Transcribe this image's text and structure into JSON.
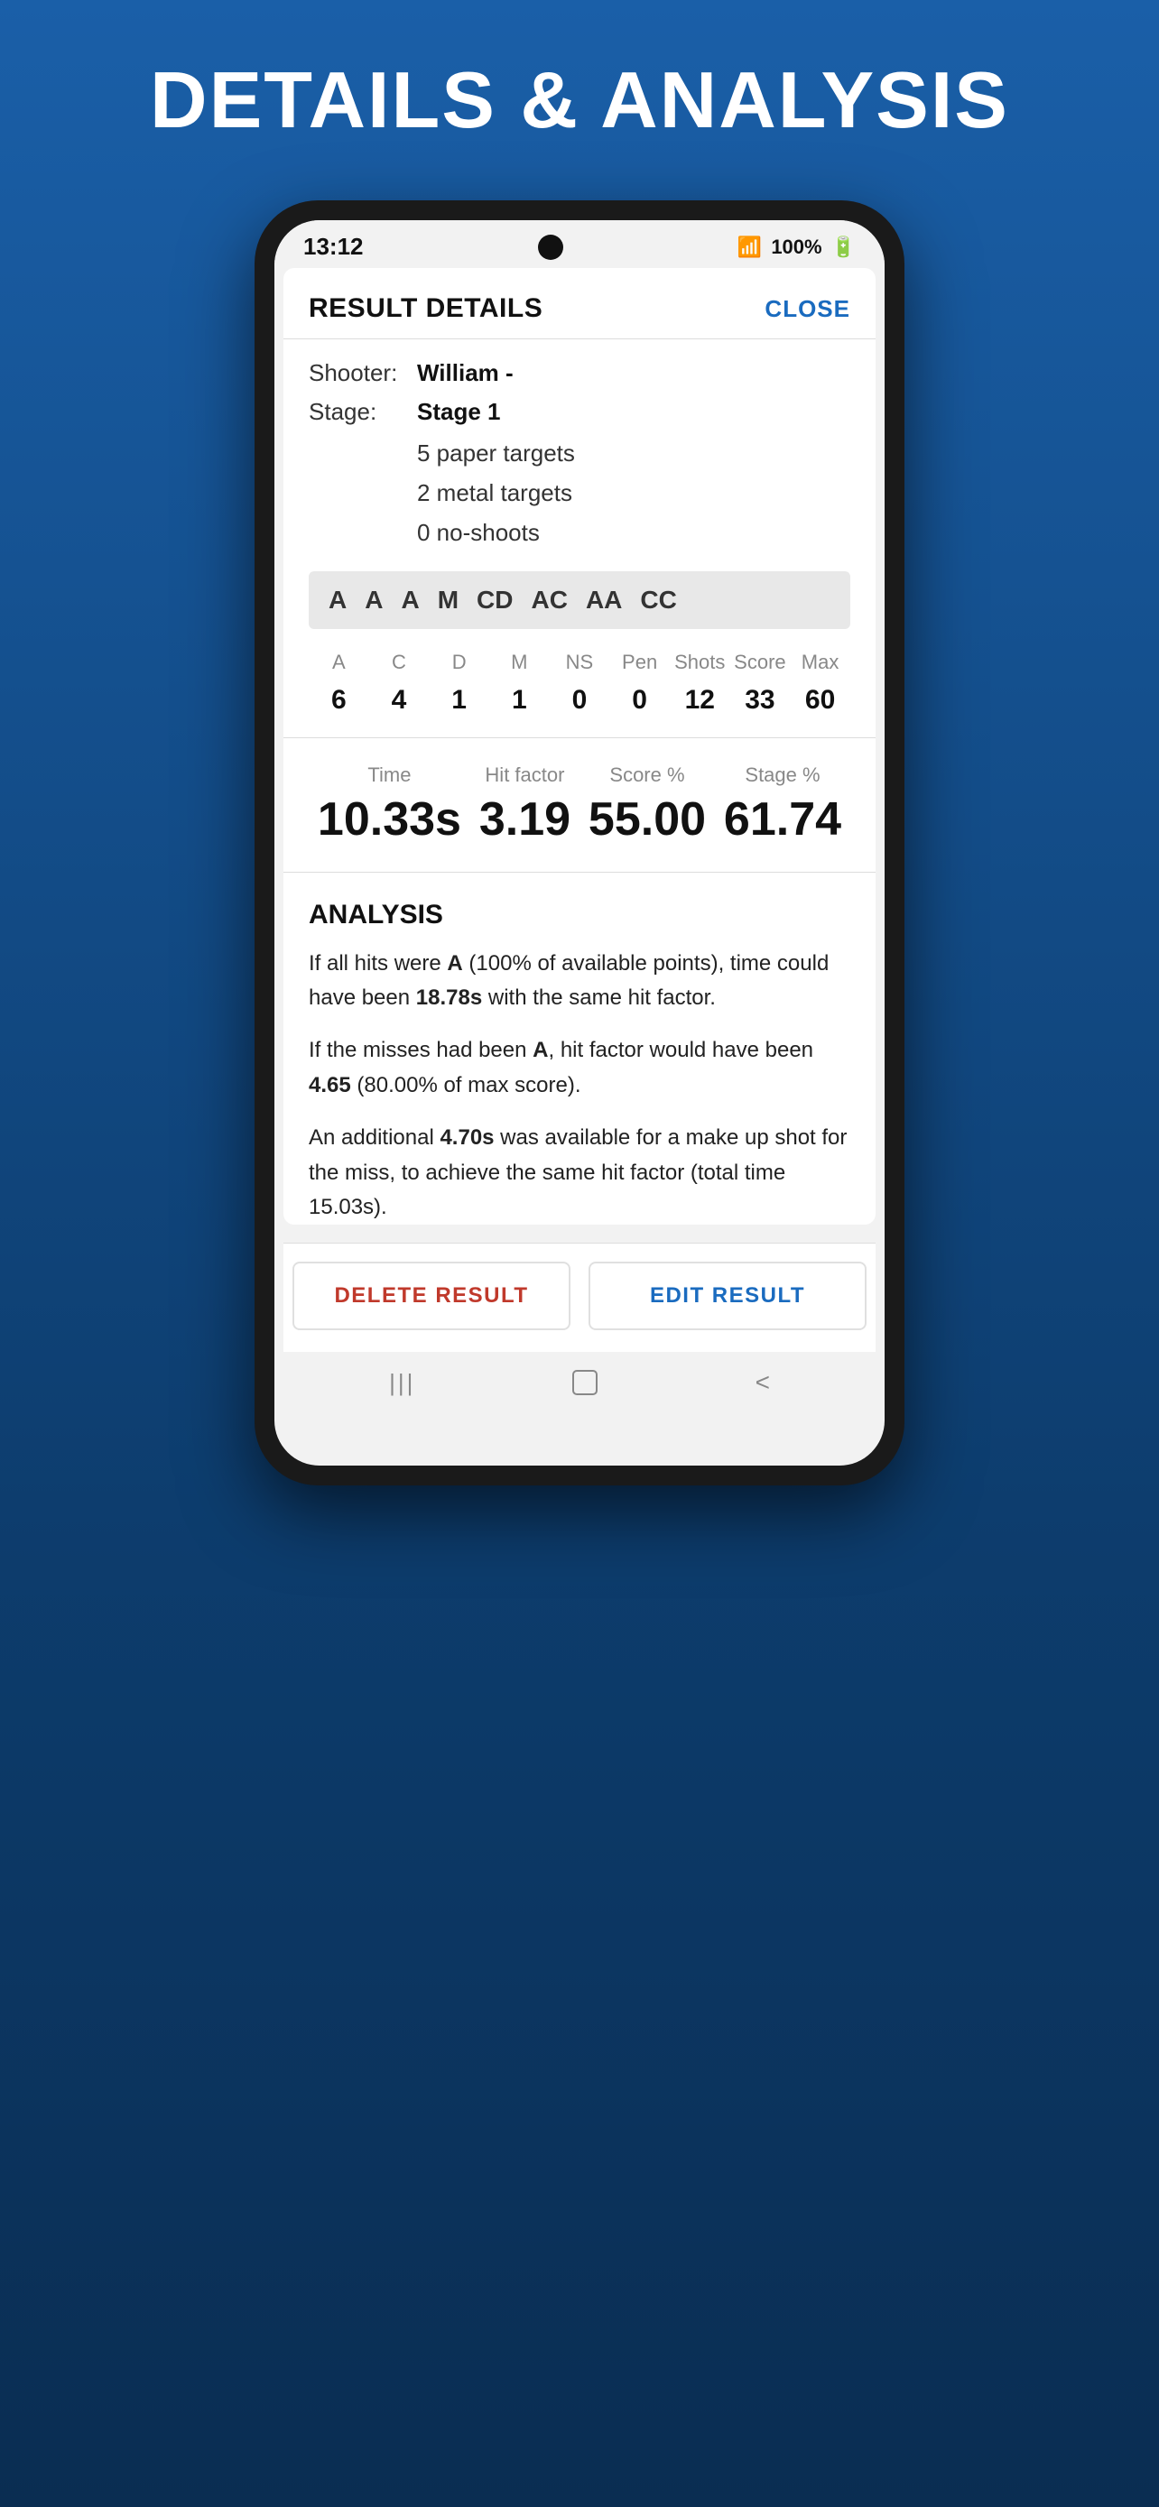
{
  "page": {
    "title": "DETAILS & ANALYSIS"
  },
  "statusBar": {
    "time": "13:12",
    "battery": "100%"
  },
  "header": {
    "title": "RESULT DETAILS",
    "closeLabel": "CLOSE"
  },
  "shooterInfo": {
    "shooterLabel": "Shooter:",
    "shooterValue": "William -",
    "stageLabel": "Stage:",
    "stageValue": "Stage 1",
    "paperTargets": "5 paper targets",
    "metalTargets": "2 metal targets",
    "noShoots": "0 no-shoots"
  },
  "hitTags": [
    "A",
    "A",
    "A",
    "M",
    "CD",
    "AC",
    "AA",
    "CC"
  ],
  "stats": {
    "columns": [
      "A",
      "C",
      "D",
      "M",
      "NS",
      "Pen",
      "Shots",
      "Score",
      "Max"
    ],
    "values": [
      "6",
      "4",
      "1",
      "1",
      "0",
      "0",
      "12",
      "33",
      "60"
    ]
  },
  "metrics": {
    "time": {
      "label": "Time",
      "value": "10.33s"
    },
    "hitFactor": {
      "label": "Hit factor",
      "value": "3.19"
    },
    "scorePercent": {
      "label": "Score %",
      "value": "55.00"
    },
    "stagePercent": {
      "label": "Stage %",
      "value": "61.74"
    }
  },
  "analysis": {
    "title": "ANALYSIS",
    "paragraph1": "If all hits were A (100% of available points), time could have been 18.78s with the same hit factor.",
    "paragraph1_bold": [
      "A",
      "18.78s"
    ],
    "paragraph2": "If the misses had been A, hit factor would have been 4.65 (80.00% of max score).",
    "paragraph2_bold": [
      "A",
      "4.65"
    ],
    "paragraph3": "An additional 4.70s was available for a make up shot for the miss, to achieve the same hit factor (total time 15.03s).",
    "paragraph3_bold": [
      "4.70s"
    ]
  },
  "buttons": {
    "delete": "DELETE RESULT",
    "edit": "EDIT RESULT"
  }
}
